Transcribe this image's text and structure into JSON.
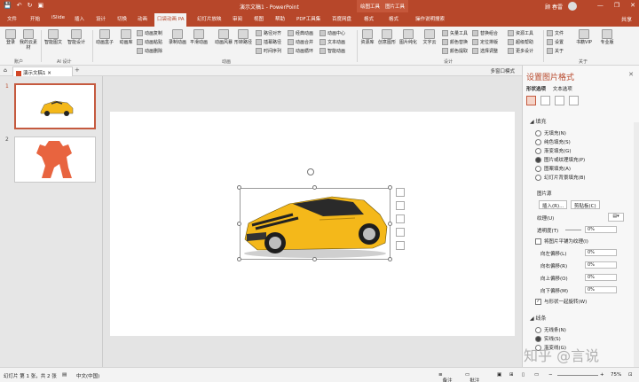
{
  "title_bar": {
    "title": "演示文稿1 - PowerPoint",
    "context_tabs": [
      "绘图工具",
      "图片工具"
    ],
    "user": "顾 春雷",
    "win_buttons": [
      "—",
      "❐",
      "✕"
    ]
  },
  "tabs": [
    "文件",
    "开始",
    "iSlide",
    "插入",
    "设计",
    "切换",
    "动画",
    "口袋动画 PA",
    "幻灯片放映",
    "审阅",
    "视图",
    "帮助",
    "PDF工具集",
    "百度网盘",
    "格式",
    "格式",
    "操作说明搜索"
  ],
  "share": "共享",
  "ribbon": {
    "buttons": [
      {
        "label": "登录",
        "icon": "login-icon"
      },
      {
        "label": "我的云素材",
        "icon": "cloud-icon"
      },
      {
        "label": "智能图文",
        "icon": "smart-graphic-icon"
      },
      {
        "label": "智能设计",
        "icon": "smart-design-icon"
      },
      {
        "label": "动画盒子",
        "icon": "box-icon"
      },
      {
        "label": "动画库",
        "icon": "library-icon"
      },
      {
        "label": "录制动画",
        "icon": "record-icon"
      },
      {
        "label": "平滑动画",
        "icon": "smooth-icon"
      },
      {
        "label": "动画风暴",
        "icon": "storm-icon"
      },
      {
        "label": "形转路径",
        "icon": "path-icon"
      },
      {
        "label": "资源库",
        "icon": "resource-icon"
      },
      {
        "label": "创意图形",
        "icon": "shape-icon"
      },
      {
        "label": "图片纯化",
        "icon": "picture-icon"
      },
      {
        "label": "文字云",
        "icon": "word-cloud-icon"
      },
      {
        "label": "书籍VIP",
        "icon": "book-icon"
      },
      {
        "label": "专业版",
        "icon": "pro-icon"
      }
    ],
    "small": [
      "动画复制",
      "动画粘贴",
      "动画删除",
      "路径对齐",
      "插幕路径",
      "时间序列",
      "经典动画",
      "动画合并",
      "动画循环",
      "动画中心",
      "文本动画",
      "智能动画",
      "矢量工具",
      "颜色替换",
      "颜色提取",
      "替换组合",
      "定位排版",
      "选择调整",
      "资源工具",
      "超级帮助",
      "更多设计",
      "文件",
      "设置",
      "关于"
    ],
    "groups": [
      "账户",
      "AI 设计",
      "动画",
      "设计",
      "关于"
    ]
  },
  "document": {
    "tab_label": "演示文稿1",
    "right_label": "多窗口模式"
  },
  "thumbnails": [
    {
      "number": "1",
      "content": "car"
    },
    {
      "number": "2",
      "content": "robot"
    }
  ],
  "format_pane": {
    "title": "设置图片格式",
    "tabs": [
      "形状选项",
      "文本选项"
    ],
    "fill_header": "填充",
    "fill_options": [
      {
        "label": "无填充(N)",
        "selected": false
      },
      {
        "label": "纯色填充(S)",
        "selected": false
      },
      {
        "label": "渐变填充(G)",
        "selected": false
      },
      {
        "label": "图片或纹理填充(P)",
        "selected": true
      },
      {
        "label": "图案填充(A)",
        "selected": false
      },
      {
        "label": "幻灯片背景填充(B)",
        "selected": false
      }
    ],
    "picture_source": "图片源",
    "insert_button": "插入(R)...",
    "clipboard_button": "剪贴板(C)",
    "texture_label": "纹理(U)",
    "transparency_label": "透明度(T)",
    "transparency_value": "0%",
    "tile_label": "将图片平铺为纹理(I)",
    "offsets": [
      {
        "label": "向左偏移(L)",
        "value": "0%"
      },
      {
        "label": "向右偏移(R)",
        "value": "0%"
      },
      {
        "label": "向上偏移(O)",
        "value": "0%"
      },
      {
        "label": "向下偏移(M)",
        "value": "0%"
      }
    ],
    "rotate_label": "与形状一起旋转(W)",
    "line_header": "线条",
    "line_options": [
      {
        "label": "无线条(N)",
        "selected": false
      },
      {
        "label": "实线(S)",
        "selected": true
      },
      {
        "label": "渐变线(G)",
        "selected": false
      }
    ]
  },
  "status_bar": {
    "slide_info": "幻灯片 第 1 张，共 2 张",
    "language": "中文(中国)",
    "notes": "备注",
    "comments": "批注",
    "zoom": "75%"
  },
  "watermark": "知乎 @言说",
  "colors": {
    "accent": "#b7472a",
    "car": "#f4b81a",
    "robot": "#e8643f"
  }
}
